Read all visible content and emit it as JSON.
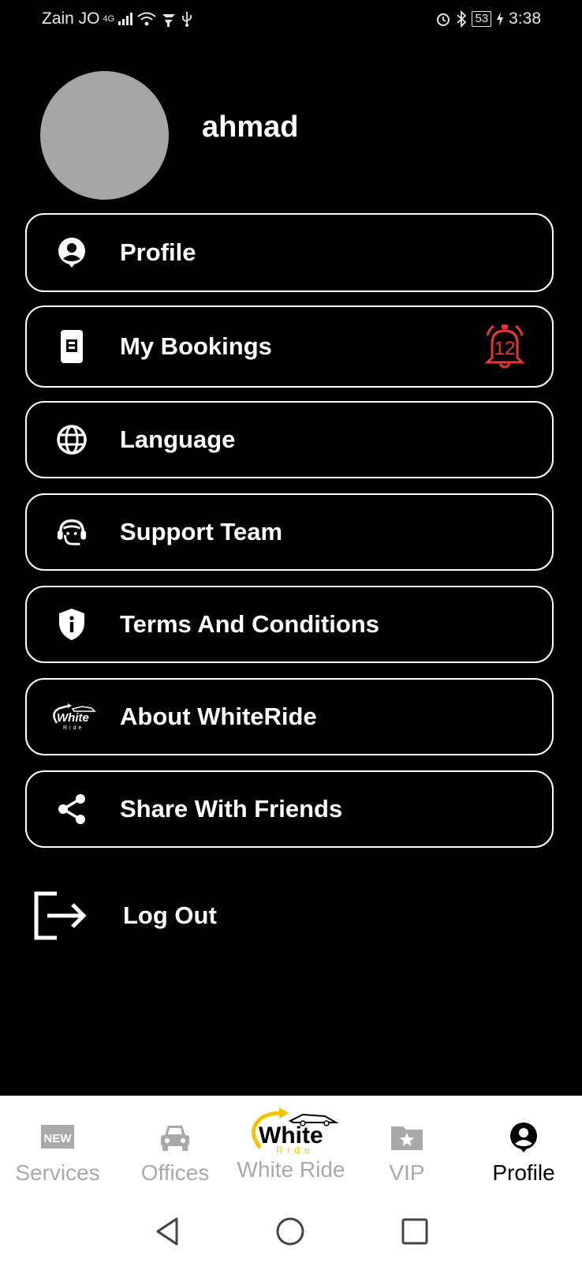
{
  "status_bar": {
    "carrier": "Zain JO",
    "network": "4G",
    "battery": "53",
    "time": "3:38"
  },
  "user": {
    "name": "ahmad"
  },
  "menu": [
    {
      "label": "Profile",
      "icon": "user-circle-icon"
    },
    {
      "label": "My Bookings",
      "icon": "booking-card-icon",
      "badge": "12"
    },
    {
      "label": "Language",
      "icon": "globe-icon"
    },
    {
      "label": "Support Team",
      "icon": "headset-icon"
    },
    {
      "label": "Terms And Conditions",
      "icon": "shield-info-icon"
    },
    {
      "label": "About WhiteRide",
      "icon": "whiteride-logo-icon",
      "logo_text": "White",
      "logo_sub": "Ride"
    },
    {
      "label": "Share With Friends",
      "icon": "share-icon"
    }
  ],
  "logout": {
    "label": "Log Out",
    "icon": "logout-icon"
  },
  "bottom_nav": [
    {
      "label": "Services",
      "icon": "new-badge-icon",
      "icon_text": "NEW",
      "active": false
    },
    {
      "label": "Offices",
      "icon": "car-icon",
      "active": false
    },
    {
      "label": "White Ride",
      "icon": "whiteride-logo-icon",
      "logo_text": "White",
      "logo_sub": "Ride",
      "active": false
    },
    {
      "label": "VIP",
      "icon": "star-folder-icon",
      "active": false
    },
    {
      "label": "Profile",
      "icon": "user-circle-icon",
      "active": true
    }
  ],
  "colors": {
    "background": "#000000",
    "badge": "#e53935",
    "inactive_nav": "#a9a9a9",
    "brand_yellow": "#f5c400"
  }
}
